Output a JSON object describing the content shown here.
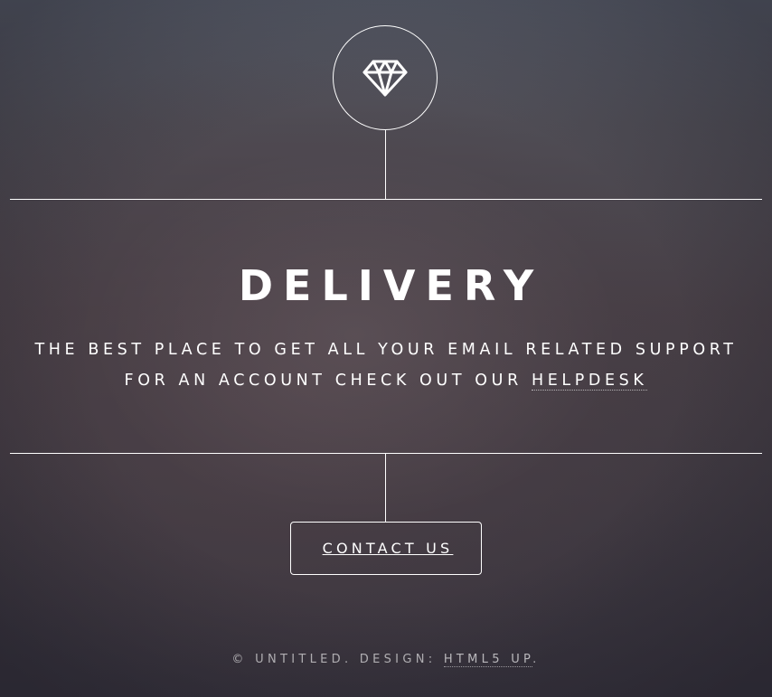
{
  "logo": {
    "icon": "diamond-icon"
  },
  "content": {
    "title": "DELIVERY",
    "description_line1": "The best place to get all your email related support",
    "description_line2": "for an account check out our",
    "helpdesk_link": "helpdesk"
  },
  "nav": {
    "contact_label": "CONTACT US"
  },
  "footer": {
    "copyright": "© UNTITLED. DESIGN: ",
    "design_link": "HTML5 UP",
    "end": "."
  }
}
